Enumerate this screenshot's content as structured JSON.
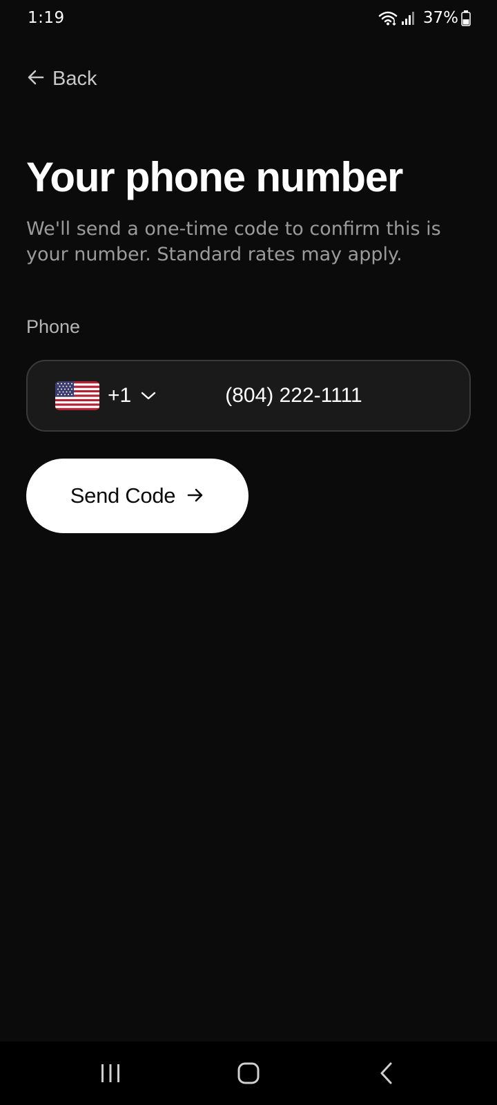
{
  "status_bar": {
    "time": "1:19",
    "battery": "37%",
    "icons": [
      "wifi-icon",
      "signal-icon",
      "battery-icon"
    ]
  },
  "back": {
    "label": "Back",
    "icon": "arrow-left-icon"
  },
  "title": "Your phone number",
  "subtitle": "We'll send a one-time code to confirm this is your number. Standard rates may apply.",
  "phone": {
    "label": "Phone",
    "country_flag": "us-flag-icon",
    "country_code": "+1",
    "value": "(804) 222-1111"
  },
  "send_button": {
    "label": "Send Code",
    "icon": "arrow-right-icon"
  },
  "nav_bar": {
    "buttons": [
      "recents-icon",
      "home-icon",
      "back-nav-icon"
    ]
  },
  "colors": {
    "background": "#0b0b0b",
    "field_background": "#1a1a1a",
    "field_border": "#3a3a3a",
    "button_background": "#ffffff",
    "subtitle_text": "#9b9b9b"
  }
}
